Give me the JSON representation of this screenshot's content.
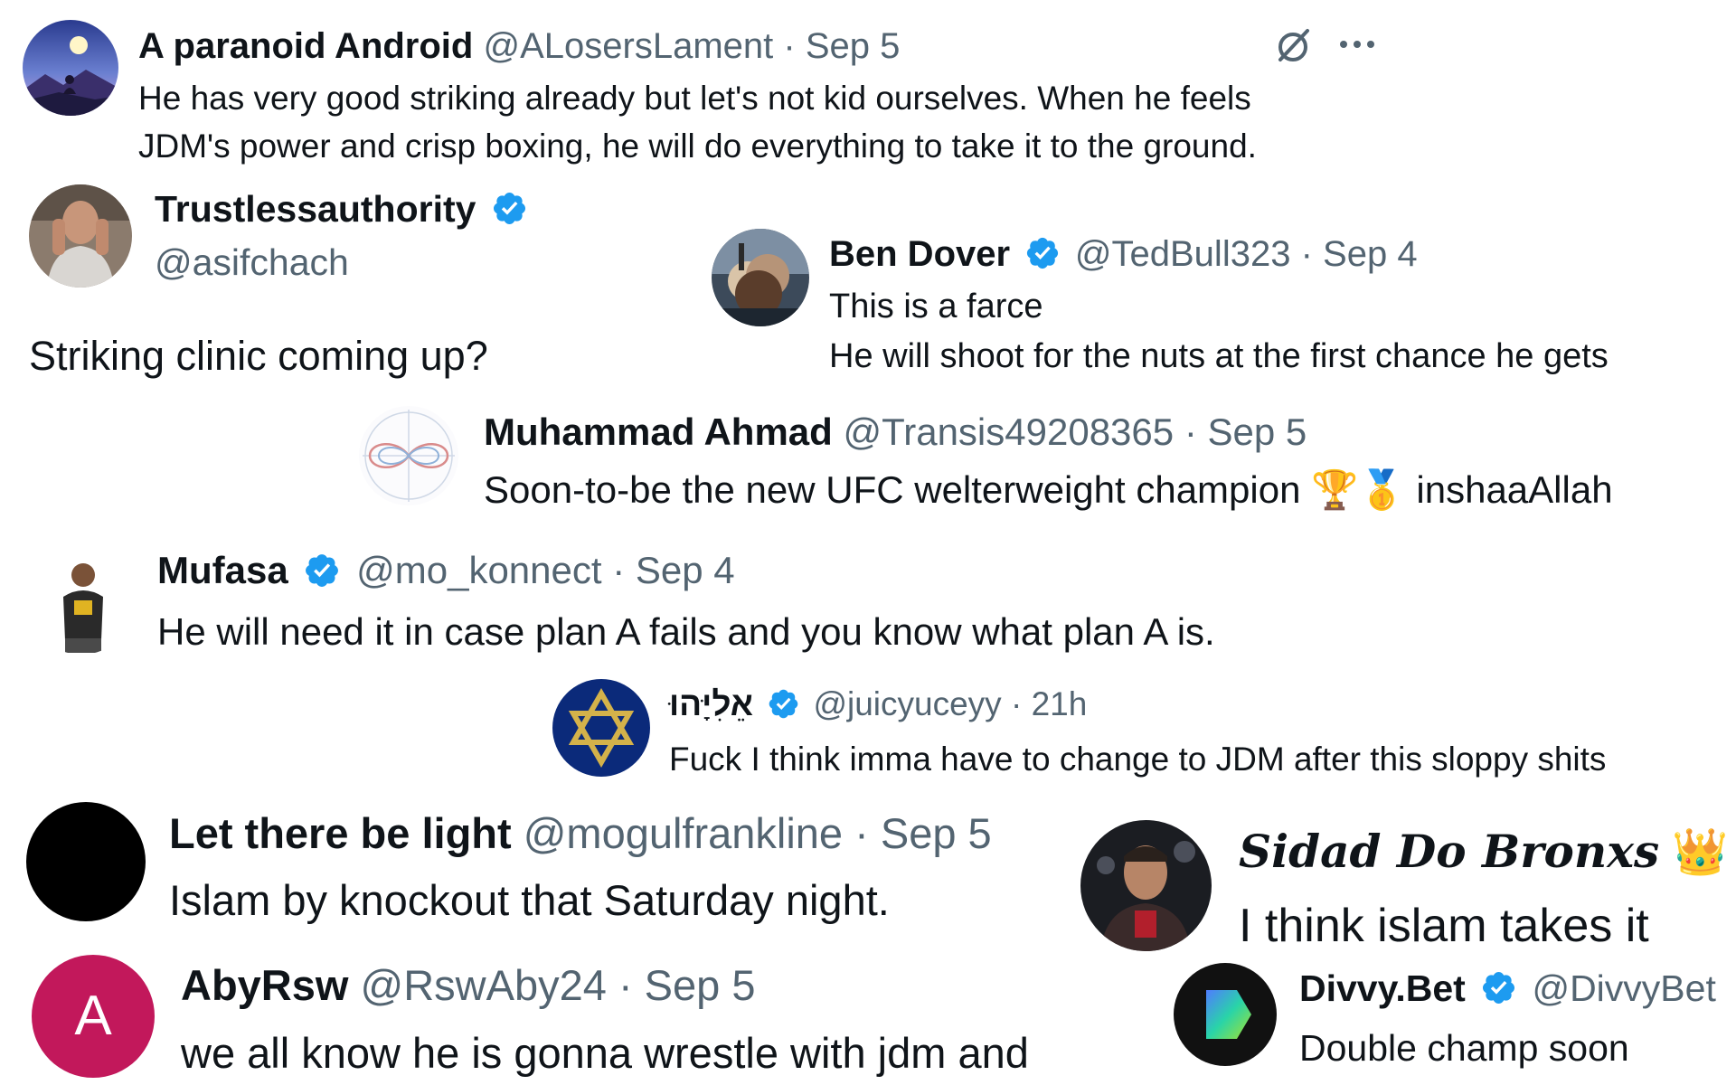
{
  "colors": {
    "verified": "#1d9bf0",
    "meta_gray": "#536471",
    "text": "#0f1419",
    "aby_avatar": "#c2185b",
    "divvy_avatar": "#111111"
  },
  "icons": {
    "grok": "slashed-circle-icon",
    "more": "more-horizontal-icon",
    "verified": "verified-badge-icon"
  },
  "posts": [
    {
      "name": "A paranoid Android",
      "handle": "@ALosersLament",
      "time": "Sep 5",
      "lines": [
        "He has very good striking already but let's not kid ourselves. When he feels",
        "JDM's power and crisp boxing, he will do everything to take it to the ground."
      ]
    },
    {
      "name": "Trustlessauthority",
      "handle": "@asifchach",
      "verified": true,
      "text": "Striking clinic coming up?"
    },
    {
      "name": "Ben Dover",
      "handle": "@TedBull323",
      "time": "Sep 4",
      "verified": true,
      "lines": [
        "This is a farce",
        "He will shoot for the nuts at the first chance he gets"
      ]
    },
    {
      "name": "Muhammad Ahmad",
      "handle": "@Transis49208365",
      "time": "Sep 5",
      "text_before": "Soon-to-be the new UFC welterweight champion",
      "emoji": "🏆🥇",
      "text_after": "inshaaAllah"
    },
    {
      "name": "Mufasa",
      "handle": "@mo_konnect",
      "time": "Sep 4",
      "verified": true,
      "text": "He will need it in case plan A fails and you know what plan A is."
    },
    {
      "name": "אֵלִיָּהוּ",
      "handle": "@juicyuceyy",
      "time": "21h",
      "verified": true,
      "text": "Fuck I think imma have to change to JDM after this sloppy shits"
    },
    {
      "name": "Let there be light",
      "handle": "@mogulfrankline",
      "time": "Sep 5",
      "text": "Islam by knockout that Saturday night."
    },
    {
      "name": "Sidad Do Bronxs",
      "emoji": "👑",
      "text": "I think islam takes it"
    },
    {
      "name": "AbyRsw",
      "handle": "@RswAby24",
      "time": "Sep 5",
      "avatar_letter": "A",
      "text": "we all know he is gonna wrestle with jdm and"
    },
    {
      "name": "Divvy.Bet",
      "handle": "@DivvyBet",
      "verified": true,
      "text": "Double champ soon"
    }
  ]
}
